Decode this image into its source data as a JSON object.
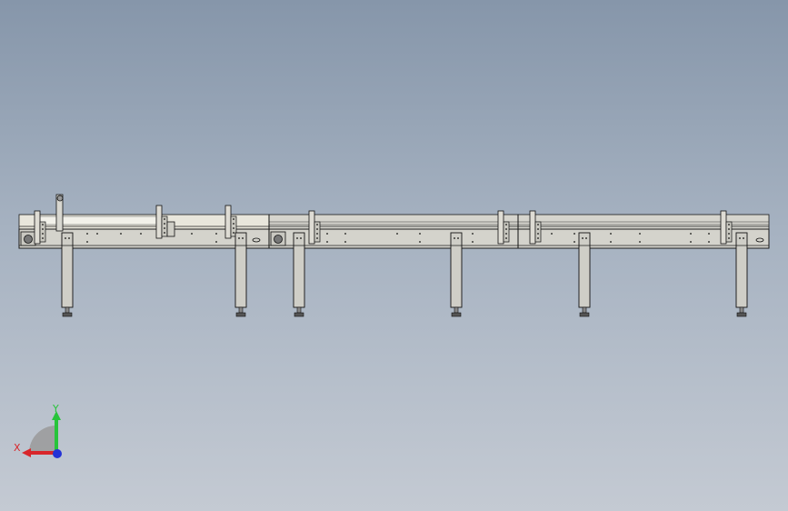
{
  "viewport": {
    "background_top": "#8696aa",
    "background_bottom": "#c4cad3"
  },
  "model": {
    "frame_color": "#d4d3cc",
    "edge_color": "#1a1a1a",
    "belt_color": "#e6e4da",
    "leg_color": "#cfcec7"
  },
  "triad": {
    "x_label": "X",
    "y_label": "Y",
    "x_color": "#d8262b",
    "y_color": "#27c43a",
    "z_color": "#2432d6"
  }
}
